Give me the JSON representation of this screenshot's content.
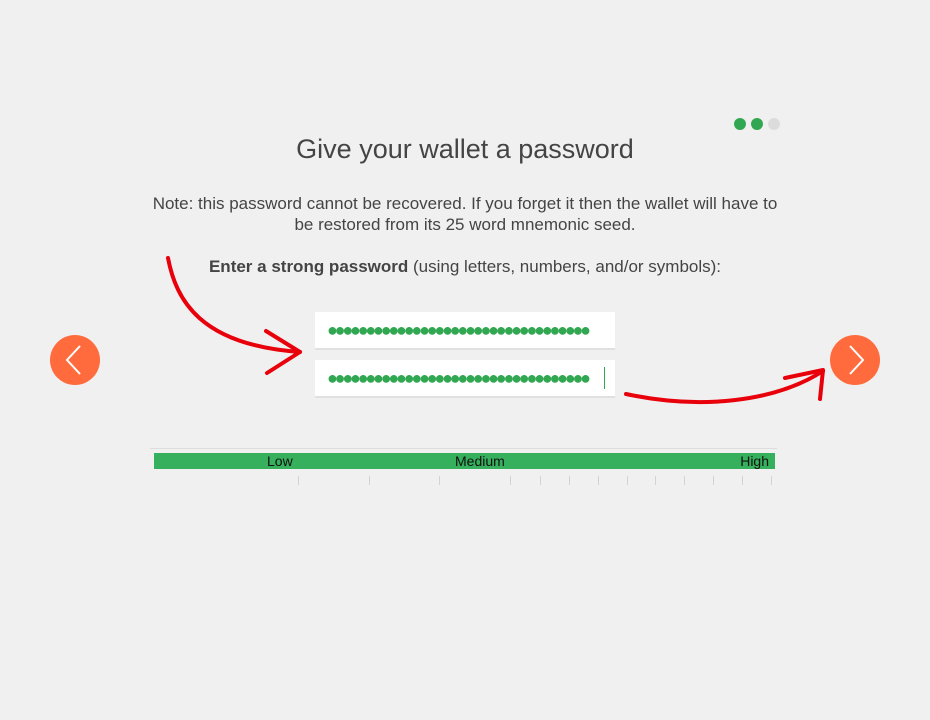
{
  "progress": {
    "total_steps": 3,
    "completed_steps": 2
  },
  "title": "Give your wallet a password",
  "note": "Note: this password cannot be recovered. If you forget it then the wallet will have to be restored from its 25 word mnemonic seed.",
  "prompt": {
    "bold": "Enter a strong password",
    "rest": " (using letters, numbers, and/or symbols):"
  },
  "password_field": {
    "value": "●●●●●●●●●●●●●●●●●●●●●●●●●●●●●●●●●●"
  },
  "confirm_field": {
    "value": "●●●●●●●●●●●●●●●●●●●●●●●●●●●●●●●●●●"
  },
  "strength_meter": {
    "low_label": "Low",
    "medium_label": "Medium",
    "high_label": "High",
    "level": 1.0,
    "color": "#36b05c"
  },
  "nav": {
    "prev_icon": "chevron-left-icon",
    "next_icon": "chevron-right-icon",
    "color": "#ff6b3c"
  },
  "annotation_color": "#e8000b"
}
